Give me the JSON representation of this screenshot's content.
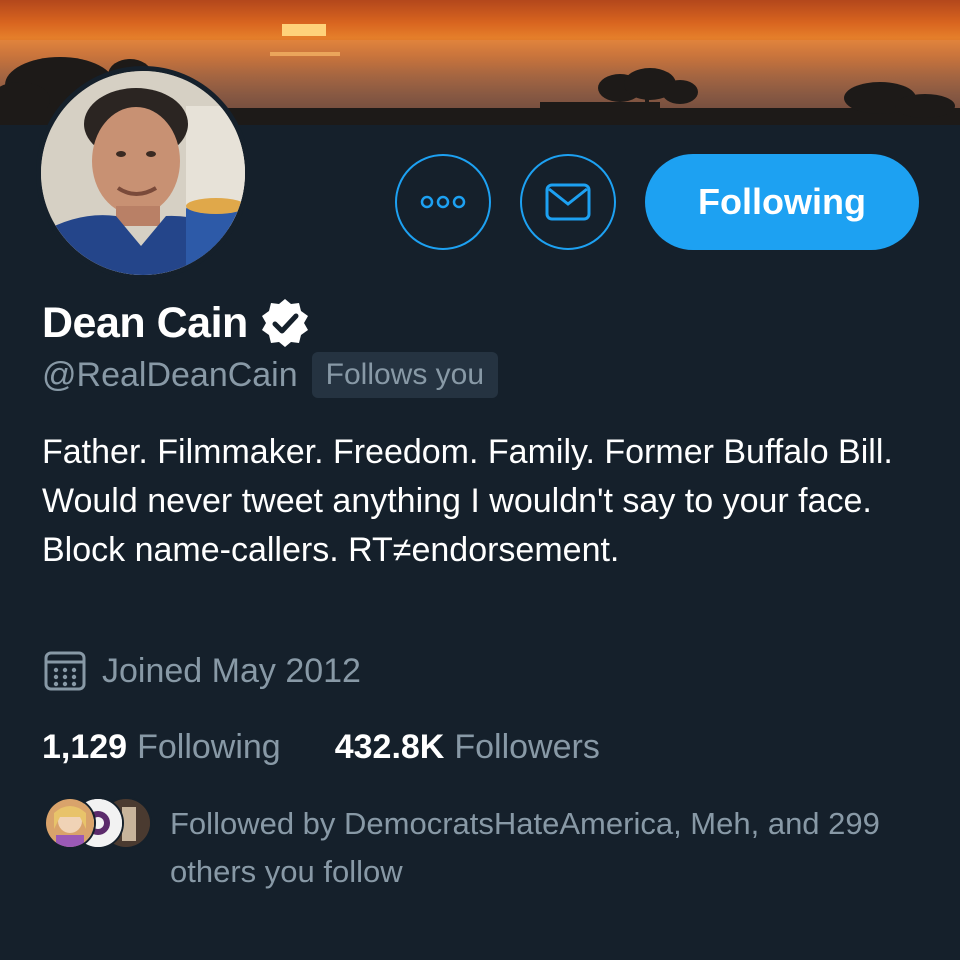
{
  "profile": {
    "name": "Dean Cain",
    "handle": "@RealDeanCain",
    "follows_you_badge": "Follows you",
    "bio": "Father. Filmmaker. Freedom. Family. Former Buffalo Bill. Would never tweet anything I wouldn't say to your face. Block name-callers. RT≠endorsement.",
    "joined": "Joined May 2012",
    "following_count": "1,129",
    "following_label": "Following",
    "followers_count": "432.8K",
    "followers_label": "Followers",
    "followed_by": "Followed by DemocratsHateAmerica, Meh, and 299 others you follow"
  },
  "actions": {
    "follow_button_label": "Following"
  },
  "icons": {
    "more": "more-dots-icon",
    "message": "envelope-icon",
    "verified": "verified-badge-icon",
    "calendar": "calendar-icon"
  },
  "colors": {
    "background": "#15202b",
    "accent": "#1da1f2",
    "secondary_text": "#8899a6",
    "badge_bg": "#253341"
  }
}
